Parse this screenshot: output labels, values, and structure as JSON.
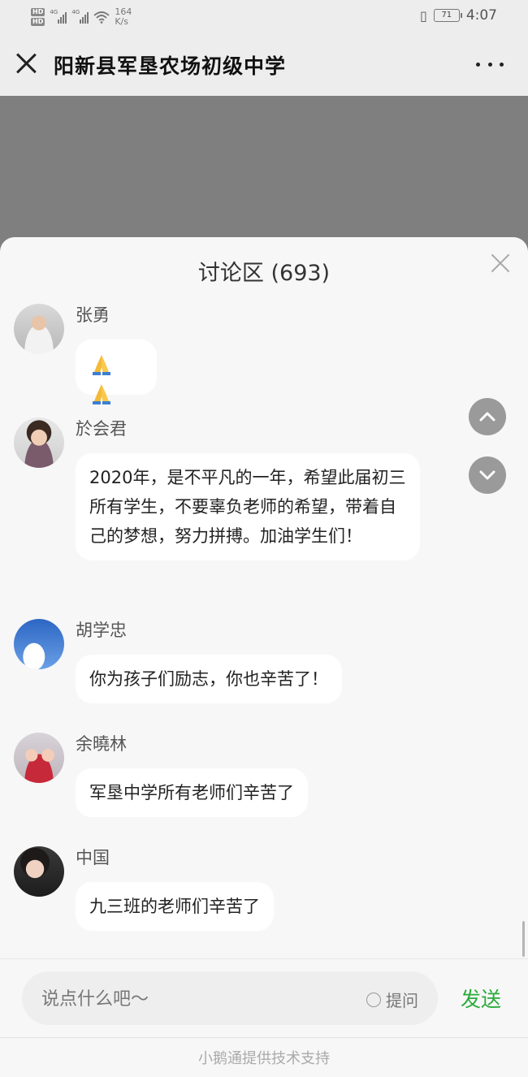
{
  "status_bar": {
    "hd1": "HD",
    "hd2": "HD",
    "net1": "4G",
    "net2": "4G",
    "speed_value": "164",
    "speed_unit": "K/s",
    "battery": "71",
    "time": "4:07"
  },
  "nav": {
    "title": "阳新县军垦农场初级中学"
  },
  "panel": {
    "title": "讨论区 (693)"
  },
  "comments": [
    {
      "name": "张勇",
      "text": ""
    },
    {
      "name": "於会君",
      "text": "2020年，是不平凡的一年，希望此届初三所有学生，不要辜负老师的希望，带着自己的梦想，努力拼搏。加油学生们！"
    },
    {
      "name": "胡学忠",
      "text": "你为孩子们励志，你也辛苦了！"
    },
    {
      "name": "余曉林",
      "text": "军垦中学所有老师们辛苦了"
    },
    {
      "name": "中国",
      "text": "九三班的老师们辛苦了"
    }
  ],
  "input": {
    "placeholder": "说点什么吧～",
    "ask_label": "提问",
    "send_label": "发送"
  },
  "footer": {
    "text": "小鹅通提供技术支持"
  },
  "colors": {
    "send": "#2aab3a",
    "backdrop": "#7f7f7f"
  }
}
